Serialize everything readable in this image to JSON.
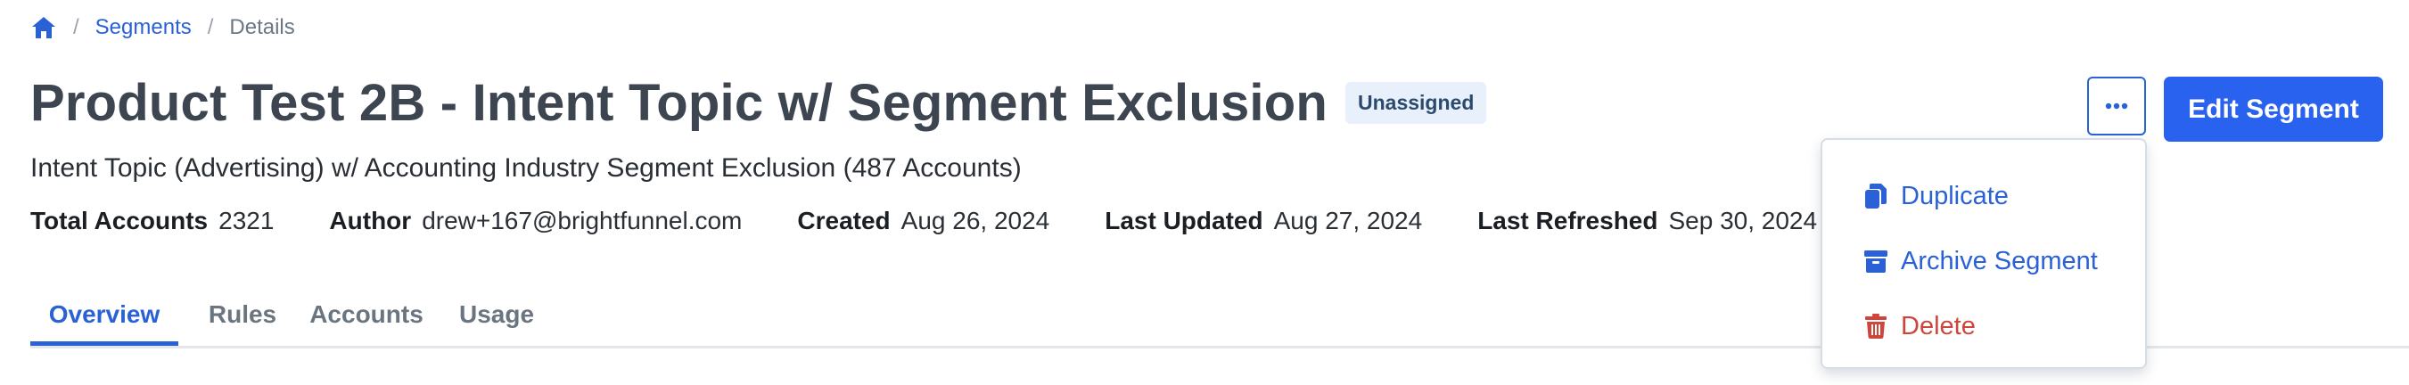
{
  "breadcrumb": {
    "home_icon": "home-icon",
    "separator": "/",
    "segments_label": "Segments",
    "current_label": "Details"
  },
  "header": {
    "title": "Product Test 2B - Intent Topic w/ Segment Exclusion",
    "status_badge": "Unassigned",
    "subtitle": "Intent Topic (Advertising) w/ Accounting Industry Segment Exclusion (487 Accounts)"
  },
  "meta": [
    {
      "label": "Total Accounts",
      "value": "2321"
    },
    {
      "label": "Author",
      "value": "drew+167@brightfunnel.com"
    },
    {
      "label": "Created",
      "value": "Aug 26, 2024"
    },
    {
      "label": "Last Updated",
      "value": "Aug 27, 2024"
    },
    {
      "label": "Last Refreshed",
      "value": "Sep 30, 2024"
    }
  ],
  "tabs": [
    {
      "label": "Overview",
      "active": true
    },
    {
      "label": "Rules",
      "active": false
    },
    {
      "label": "Accounts",
      "active": false
    },
    {
      "label": "Usage",
      "active": false
    }
  ],
  "actions": {
    "more_icon": "ellipsis-icon",
    "edit_label": "Edit Segment"
  },
  "dropdown": {
    "items": [
      {
        "label": "Duplicate",
        "icon": "copy-icon"
      },
      {
        "label": "Archive Segment",
        "icon": "archive-icon"
      },
      {
        "label": "Delete",
        "icon": "trash-icon"
      }
    ]
  },
  "colors": {
    "accent": "#2a62d6",
    "primary_button": "#2a62f0",
    "danger": "#d0453b",
    "badge_bg": "#e8f1fb"
  }
}
